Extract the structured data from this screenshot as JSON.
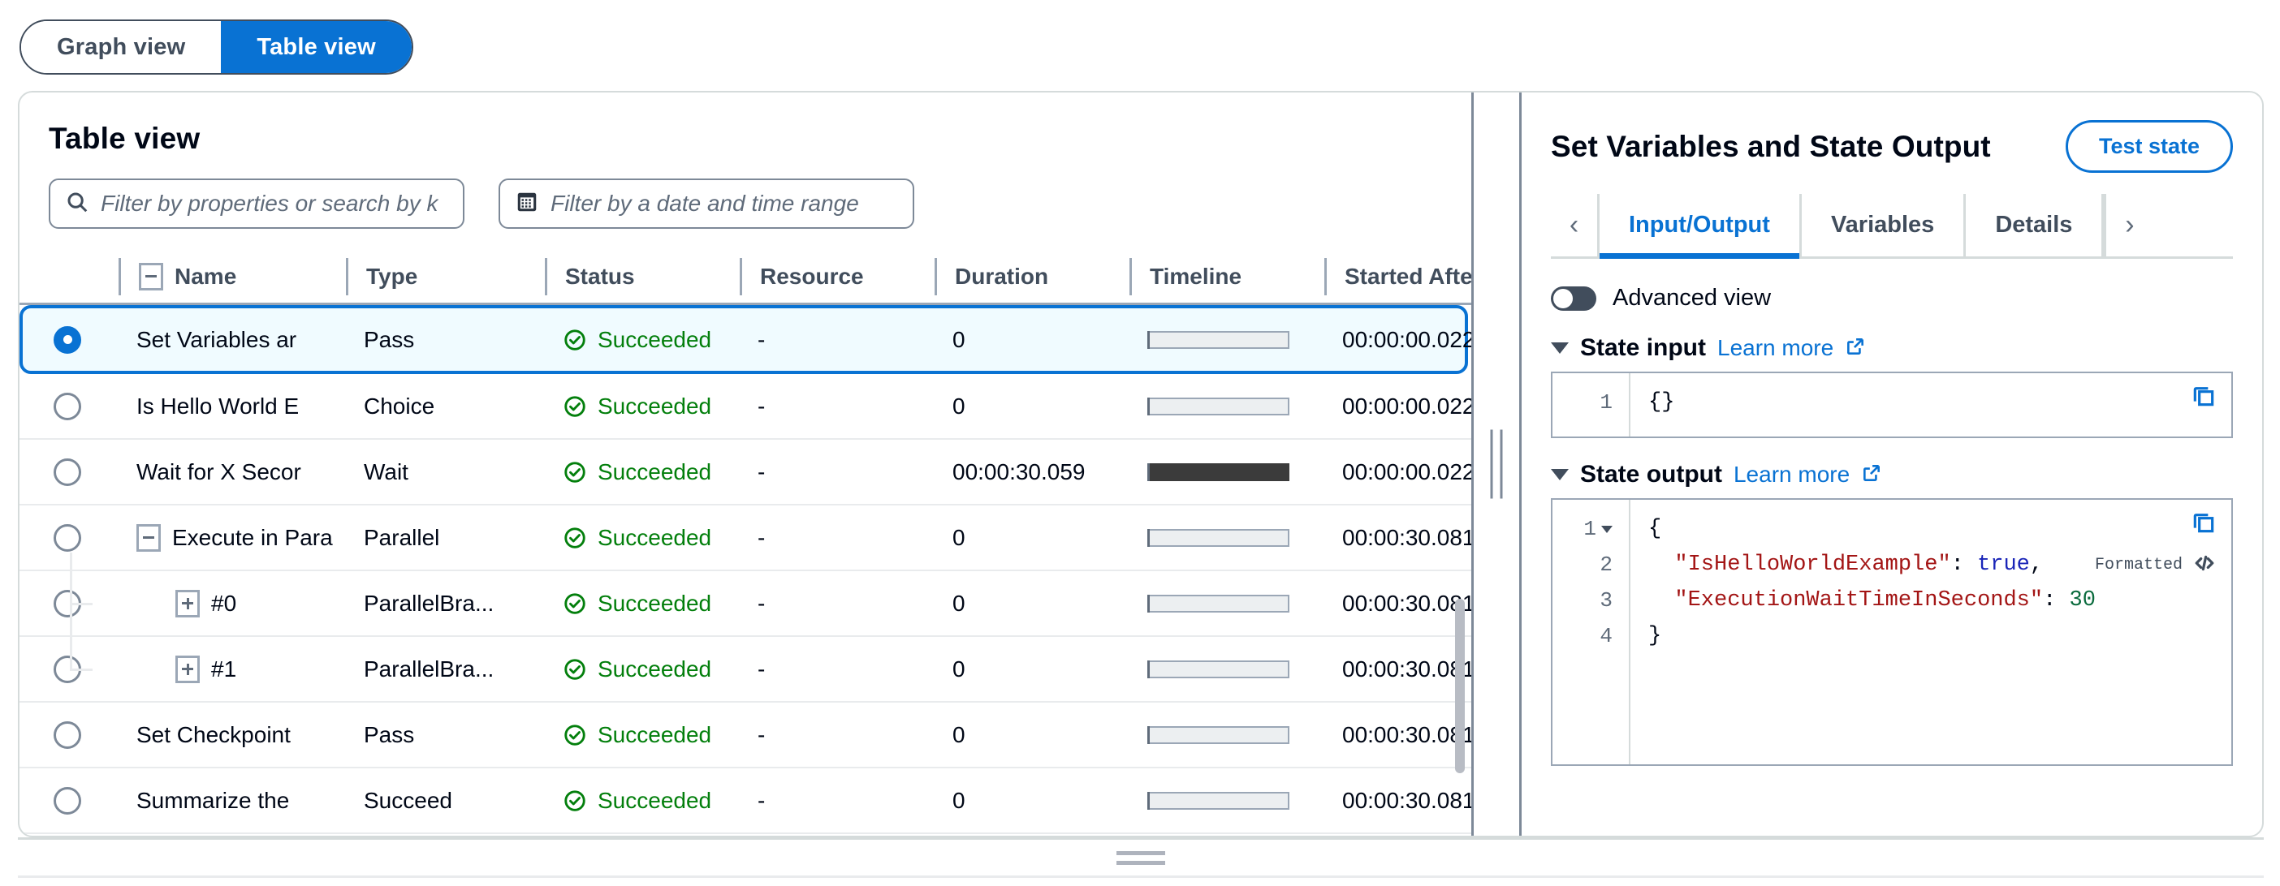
{
  "view_toggle": {
    "graph_label": "Graph view",
    "table_label": "Table view",
    "active": "Table view",
    "active_color": "#0972d3"
  },
  "table_panel": {
    "title": "Table view",
    "search": {
      "placeholder": "Filter by properties or search by k",
      "icon": "search-icon"
    },
    "daterange": {
      "placeholder": "Filter by a date and time range",
      "icon": "calendar-icon"
    },
    "columns": [
      "Name",
      "Type",
      "Status",
      "Resource",
      "Duration",
      "Timeline",
      "Started After"
    ],
    "rows": [
      {
        "name": "Set Variables ar",
        "type": "Pass",
        "status": "Succeeded",
        "resource": "-",
        "duration": "0",
        "started_after": "00:00:00.022",
        "timeline_fill": 0,
        "selected": true,
        "indent": 0,
        "toggle": "none"
      },
      {
        "name": "Is Hello World E",
        "type": "Choice",
        "status": "Succeeded",
        "resource": "-",
        "duration": "0",
        "started_after": "00:00:00.022",
        "timeline_fill": 0,
        "selected": false,
        "indent": 0,
        "toggle": "none"
      },
      {
        "name": "Wait for X Secor",
        "type": "Wait",
        "status": "Succeeded",
        "resource": "-",
        "duration": "00:00:30.059",
        "started_after": "00:00:00.022",
        "timeline_fill": 100,
        "selected": false,
        "indent": 0,
        "toggle": "none"
      },
      {
        "name": "Execute in Para",
        "type": "Parallel",
        "status": "Succeeded",
        "resource": "-",
        "duration": "0",
        "started_after": "00:00:30.081",
        "timeline_fill": 0,
        "selected": false,
        "indent": 0,
        "toggle": "minus"
      },
      {
        "name": "#0",
        "type": "ParallelBra...",
        "status": "Succeeded",
        "resource": "-",
        "duration": "0",
        "started_after": "00:00:30.081",
        "timeline_fill": 0,
        "selected": false,
        "indent": 1,
        "toggle": "plus"
      },
      {
        "name": "#1",
        "type": "ParallelBra...",
        "status": "Succeeded",
        "resource": "-",
        "duration": "0",
        "started_after": "00:00:30.081",
        "timeline_fill": 0,
        "selected": false,
        "indent": 1,
        "toggle": "plus"
      },
      {
        "name": "Set Checkpoint",
        "type": "Pass",
        "status": "Succeeded",
        "resource": "-",
        "duration": "0",
        "started_after": "00:00:30.081",
        "timeline_fill": 0,
        "selected": false,
        "indent": 0,
        "toggle": "none"
      },
      {
        "name": "Summarize the",
        "type": "Succeed",
        "status": "Succeeded",
        "resource": "-",
        "duration": "0",
        "started_after": "00:00:30.081",
        "timeline_fill": 0,
        "selected": false,
        "indent": 0,
        "toggle": "none"
      }
    ],
    "status_color": "#037f0c"
  },
  "detail_panel": {
    "title": "Set Variables and State Output",
    "test_state_label": "Test state",
    "tabs": [
      {
        "label": "Input/Output",
        "active": true
      },
      {
        "label": "Variables",
        "active": false
      },
      {
        "label": "Details",
        "active": false
      }
    ],
    "prev_arrow": "‹",
    "next_arrow": "›",
    "advanced_view_label": "Advanced view",
    "advanced_view_on": false,
    "state_input": {
      "title": "State input",
      "learn_more": "Learn more",
      "lines": [
        {
          "num": "1",
          "text": "{}"
        }
      ]
    },
    "state_output": {
      "title": "State output",
      "learn_more": "Learn more",
      "formatted_label": "Formatted",
      "lines": [
        {
          "num": "1",
          "foldable": true
        },
        {
          "num": "2",
          "foldable": false
        },
        {
          "num": "3",
          "foldable": false
        },
        {
          "num": "4",
          "foldable": false
        }
      ],
      "code": {
        "line1": "{",
        "line2_key": "\"IsHelloWorldExample\"",
        "line2_val": "true",
        "line3_key": "\"ExecutionWaitTimeInSeconds\"",
        "line3_val": "30",
        "line4": "}"
      }
    }
  }
}
